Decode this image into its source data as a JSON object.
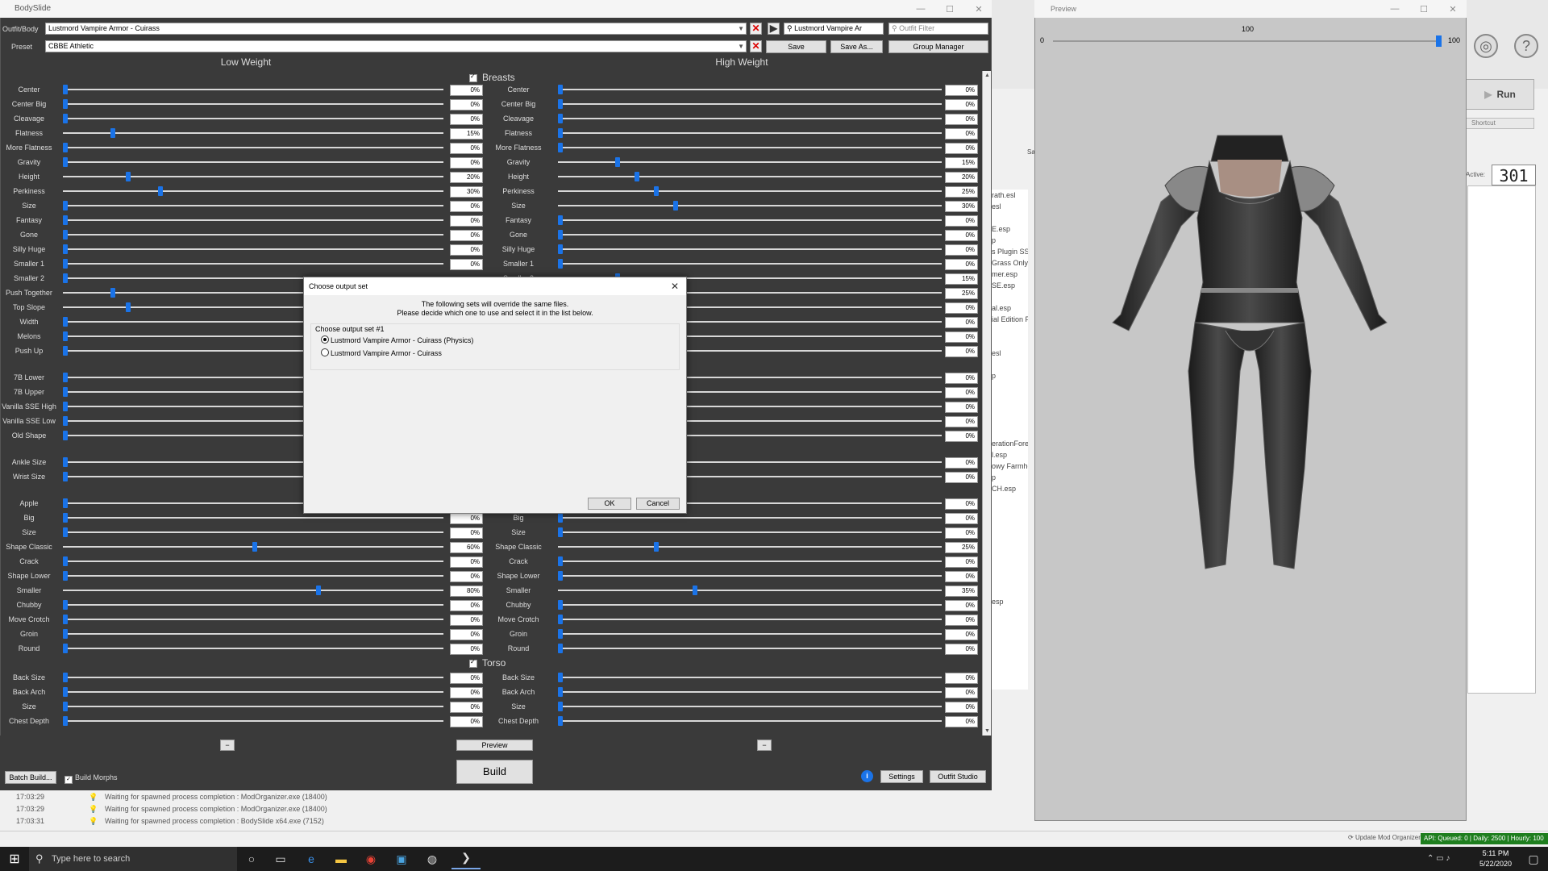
{
  "bodyslide": {
    "title": "BodySlide",
    "outfit_label": "Outfit/Body",
    "outfit_value": "Lustmord Vampire Armor - Cuirass",
    "outfit_search": "Lustmord Vampire Ar",
    "outfit_filter_placeholder": "Outfit Filter",
    "preset_label": "Preset",
    "preset_value": "CBBE Athletic",
    "save_label": "Save",
    "save_as_label": "Save As...",
    "group_manager_label": "Group Manager",
    "low_weight_label": "Low Weight",
    "high_weight_label": "High Weight",
    "sections": [
      {
        "name": "Breasts"
      },
      {
        "name": "Torso"
      }
    ],
    "preview_label": "Preview",
    "build_label": "Build",
    "batch_build_label": "Batch Build...",
    "build_morphs_label": "Build Morphs",
    "settings_label": "Settings",
    "outfit_studio_label": "Outfit Studio",
    "minus_label": "−",
    "info_label": "i"
  },
  "sliders": [
    {
      "name": "Center",
      "low": "0%",
      "high": "0%",
      "lv": 0,
      "hv": 0
    },
    {
      "name": "Center Big",
      "low": "0%",
      "high": "0%",
      "lv": 0,
      "hv": 0
    },
    {
      "name": "Cleavage",
      "low": "0%",
      "high": "0%",
      "lv": 0,
      "hv": 0
    },
    {
      "name": "Flatness",
      "low": "15%",
      "high": "0%",
      "lv": 15,
      "hv": 0
    },
    {
      "name": "More Flatness",
      "low": "0%",
      "high": "0%",
      "lv": 0,
      "hv": 0
    },
    {
      "name": "Gravity",
      "low": "0%",
      "high": "15%",
      "lv": 0,
      "hv": 15
    },
    {
      "name": "Height",
      "low": "20%",
      "high": "20%",
      "lv": 20,
      "hv": 20
    },
    {
      "name": "Perkiness",
      "low": "30%",
      "high": "25%",
      "lv": 30,
      "hv": 25
    },
    {
      "name": "Size",
      "low": "0%",
      "high": "30%",
      "lv": 0,
      "hv": 30
    },
    {
      "name": "Fantasy",
      "low": "0%",
      "high": "0%",
      "lv": 0,
      "hv": 0
    },
    {
      "name": "Gone",
      "low": "0%",
      "high": "0%",
      "lv": 0,
      "hv": 0
    },
    {
      "name": "Silly Huge",
      "low": "0%",
      "high": "0%",
      "lv": 0,
      "hv": 0
    },
    {
      "name": "Smaller 1",
      "low": "0%",
      "high": "0%",
      "lv": 0,
      "hv": 0
    },
    {
      "name": "Smaller 2",
      "low": "",
      "high": "15%",
      "lv": 0,
      "hv": 15
    },
    {
      "name": "Push Together",
      "low": "",
      "high": "25%",
      "lv": 15,
      "hv": 25
    },
    {
      "name": "Top Slope",
      "low": "",
      "high": "0%",
      "lv": 20,
      "hv": 0
    },
    {
      "name": "Width",
      "low": "",
      "high": "0%",
      "lv": 0,
      "hv": 0
    },
    {
      "name": "Melons",
      "low": "",
      "high": "0%",
      "lv": 0,
      "hv": 0
    },
    {
      "name": "Push Up",
      "low": "",
      "high": "0%",
      "lv": 0,
      "hv": 0
    },
    {
      "name": "",
      "gap": true
    },
    {
      "name": "7B Lower",
      "low": "",
      "high": "0%",
      "lv": 0,
      "hv": 0
    },
    {
      "name": "7B Upper",
      "low": "",
      "high": "0%",
      "lv": 0,
      "hv": 0
    },
    {
      "name": "Vanilla SSE High",
      "low": "",
      "high": "0%",
      "lv": 0,
      "hv": 0
    },
    {
      "name": "Vanilla SSE Low",
      "low": "",
      "high": "0%",
      "lv": 0,
      "hv": 0
    },
    {
      "name": "Old Shape",
      "low": "",
      "high": "0%",
      "lv": 0,
      "hv": 0
    },
    {
      "name": "",
      "gap": true
    },
    {
      "name": "Ankle Size",
      "low": "",
      "high": "0%",
      "lv": 0,
      "hv": 0
    },
    {
      "name": "Wrist Size",
      "low": "",
      "high": "0%",
      "lv": 0,
      "hv": 0
    },
    {
      "name": "",
      "gap": true
    },
    {
      "name": "Apple",
      "low": "",
      "high": "0%",
      "lv": 0,
      "hv": 0
    },
    {
      "name": "Big",
      "low": "0%",
      "high": "0%",
      "lv": 0,
      "hv": 0
    },
    {
      "name": "Size",
      "low": "0%",
      "high": "0%",
      "lv": 0,
      "hv": 0
    },
    {
      "name": "Shape Classic",
      "low": "60%",
      "high": "25%",
      "lv": 60,
      "hv": 25
    },
    {
      "name": "Crack",
      "low": "0%",
      "high": "0%",
      "lv": 0,
      "hv": 0
    },
    {
      "name": "Shape Lower",
      "low": "0%",
      "high": "0%",
      "lv": 0,
      "hv": 0
    },
    {
      "name": "Smaller",
      "low": "80%",
      "high": "35%",
      "lv": 80,
      "hv": 35
    },
    {
      "name": "Chubby",
      "low": "0%",
      "high": "0%",
      "lv": 0,
      "hv": 0
    },
    {
      "name": "Move Crotch",
      "low": "0%",
      "high": "0%",
      "lv": 0,
      "hv": 0
    },
    {
      "name": "Groin",
      "low": "0%",
      "high": "0%",
      "lv": 0,
      "hv": 0
    },
    {
      "name": "Round",
      "low": "0%",
      "high": "0%",
      "lv": 0,
      "hv": 0
    },
    {
      "name": "",
      "section": "Torso"
    },
    {
      "name": "Back Size",
      "low": "0%",
      "high": "0%",
      "lv": 0,
      "hv": 0
    },
    {
      "name": "Back Arch",
      "low": "0%",
      "high": "0%",
      "lv": 0,
      "hv": 0
    },
    {
      "name": "Size",
      "low": "0%",
      "high": "0%",
      "lv": 0,
      "hv": 0
    },
    {
      "name": "Chest Depth",
      "low": "0%",
      "high": "0%",
      "lv": 0,
      "hv": 0
    }
  ],
  "dialog": {
    "title": "Choose output set",
    "message_line1": "The following sets will override the same files.",
    "message_line2": "Please decide which one to use and select it in the list below.",
    "group_label": "Choose output set #1",
    "options": [
      {
        "label": "Lustmord Vampire Armor - Cuirass (Physics)",
        "selected": true
      },
      {
        "label": "Lustmord Vampire Armor - Cuirass",
        "selected": false
      }
    ],
    "ok_label": "OK",
    "cancel_label": "Cancel"
  },
  "preview": {
    "title": "Preview",
    "slider_min": "0",
    "slider_max": "100",
    "slider_value": "100",
    "level": 100
  },
  "mod_organizer": {
    "run_label": "Run",
    "shortcut_label": "Shortcut",
    "active_label": "Active:",
    "active_count": "301",
    "saves_tab": "Saves",
    "plugins": [
      "rath.esl",
      "esl",
      "",
      "E.esp",
      "p",
      "s Plugin SSE V",
      "Grass Only.e",
      "mer.esp",
      "SE.esp",
      "",
      "al.esp",
      "ial Edition P",
      "",
      "",
      "esl",
      "",
      "p",
      "",
      "",
      "",
      "",
      "",
      "erationFores",
      "l.esp",
      "owy Farmho",
      "p",
      "CH.esp",
      "",
      "",
      "",
      "",
      "",
      "",
      "",
      "",
      "",
      "esp"
    ],
    "update_label": "Update Mod Organizer",
    "api_status": "API: Queued: 0 | Daily: 2500 | Hourly: 100"
  },
  "log": [
    {
      "time": "17:03:29",
      "text": "Waiting for spawned process completion : ModOrganizer.exe (18400)"
    },
    {
      "time": "17:03:29",
      "text": "Waiting for spawned process completion : ModOrganizer.exe (18400)"
    },
    {
      "time": "17:03:31",
      "text": "Waiting for spawned process completion : BodySlide x64.exe (7152)"
    }
  ],
  "taskbar": {
    "search_placeholder": "Type here to search",
    "time": "5:11 PM",
    "date": "5/22/2020"
  },
  "colors": {
    "accent": "#1a73e8",
    "api_green": "#1e7e1e",
    "panel_dark": "#3a3a3a"
  }
}
